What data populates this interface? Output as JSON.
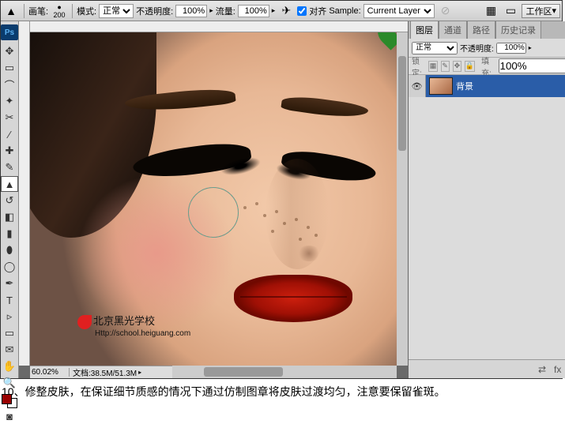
{
  "optbar": {
    "brush_label": "画笔:",
    "brush_size": "200",
    "mode_label": "模式:",
    "mode_value": "正常",
    "opacity_label": "不透明度:",
    "opacity_value": "100%",
    "flow_label": "流量:",
    "flow_value": "100%",
    "align_label": "对齐",
    "sample_label": "Sample:",
    "sample_value": "Current Layer",
    "workspace_label": "工作区"
  },
  "status": {
    "zoom": "60.02%",
    "doc": "文档:38.5M/51.3M"
  },
  "panel": {
    "tabs": [
      "图层",
      "通道",
      "路径",
      "历史记录"
    ],
    "blend": "正常",
    "opacity_label": "不透明度:",
    "opacity_value": "100%",
    "lock_label": "锁定:",
    "fill_label": "填充:",
    "fill_value": "100%",
    "layer_name": "背景"
  },
  "watermark": {
    "name": "北京黑光学校",
    "url": "Http://school.heiguang.com"
  },
  "caption": "10、修整皮肤，在保证细节质感的情况下通过仿制图章将皮肤过渡均匀，注意要保留雀斑。"
}
